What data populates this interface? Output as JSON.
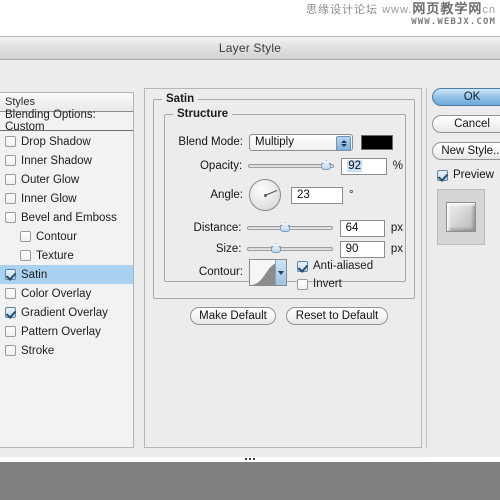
{
  "watermark": {
    "line1_cn": "思缘设计论坛",
    "line1_www": "www.",
    "line1_site": "网页教学网",
    "line1_tld": "cn",
    "line2": "WWW.WEBJX.COM"
  },
  "window": {
    "title": "Layer Style"
  },
  "styles_panel": {
    "header": "Styles",
    "blending_options": "Blending Options: Custom",
    "effects": [
      {
        "label": "Drop Shadow",
        "checked": false,
        "indent": false,
        "selected": false
      },
      {
        "label": "Inner Shadow",
        "checked": false,
        "indent": false,
        "selected": false
      },
      {
        "label": "Outer Glow",
        "checked": false,
        "indent": false,
        "selected": false
      },
      {
        "label": "Inner Glow",
        "checked": false,
        "indent": false,
        "selected": false
      },
      {
        "label": "Bevel and Emboss",
        "checked": false,
        "indent": false,
        "selected": false
      },
      {
        "label": "Contour",
        "checked": false,
        "indent": true,
        "selected": false
      },
      {
        "label": "Texture",
        "checked": false,
        "indent": true,
        "selected": false
      },
      {
        "label": "Satin",
        "checked": true,
        "indent": false,
        "selected": true
      },
      {
        "label": "Color Overlay",
        "checked": false,
        "indent": false,
        "selected": false
      },
      {
        "label": "Gradient Overlay",
        "checked": true,
        "indent": false,
        "selected": false
      },
      {
        "label": "Pattern Overlay",
        "checked": false,
        "indent": false,
        "selected": false
      },
      {
        "label": "Stroke",
        "checked": false,
        "indent": false,
        "selected": false
      }
    ]
  },
  "satin": {
    "group_title": "Satin",
    "structure_title": "Structure",
    "blend_mode": {
      "label": "Blend Mode:",
      "value": "Multiply",
      "color": "#000000"
    },
    "opacity": {
      "label": "Opacity:",
      "value": "92",
      "unit": "%",
      "percent": 92
    },
    "angle": {
      "label": "Angle:",
      "value": "23",
      "unit": "°",
      "degrees": 23
    },
    "distance": {
      "label": "Distance:",
      "value": "64",
      "unit": "px",
      "percent": 45
    },
    "size": {
      "label": "Size:",
      "value": "90",
      "unit": "px",
      "percent": 34
    },
    "contour": {
      "label": "Contour:"
    },
    "anti_aliased": {
      "label": "Anti-aliased",
      "checked": true
    },
    "invert": {
      "label": "Invert",
      "checked": false
    },
    "make_default": "Make Default",
    "reset_to_default": "Reset to Default"
  },
  "actions": {
    "ok": "OK",
    "cancel": "Cancel",
    "new_style": "New Style...",
    "preview": "Preview",
    "preview_checked": true
  },
  "colors": {
    "selection_blue": "#a9d1f0",
    "primary_button": "#93c2e8",
    "dialog_bg": "#ececec",
    "desktop_gray": "#808080",
    "swatch_black": "#000000"
  }
}
